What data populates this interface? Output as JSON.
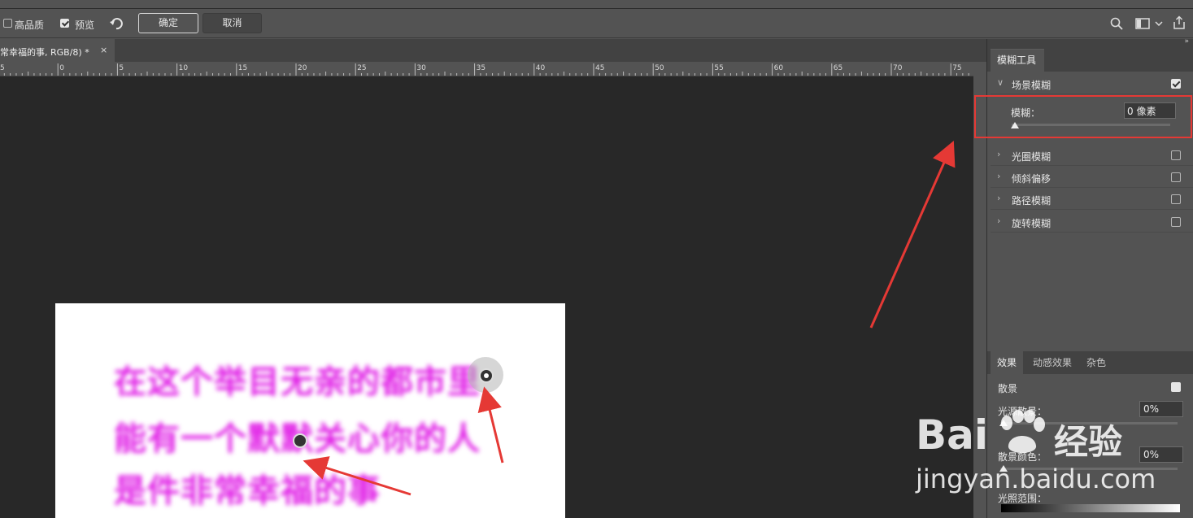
{
  "options_bar": {
    "high_quality_label": "高品质",
    "high_quality_checked": false,
    "preview_label": "预览",
    "preview_checked": true,
    "ok_label": "确定",
    "cancel_label": "取消",
    "icons": [
      "undo-icon",
      "search-icon",
      "workspace-icon",
      "chevron-down-icon",
      "share-icon"
    ]
  },
  "document_tab": {
    "title": "常幸福的事, RGB/8) *",
    "close_label": "×"
  },
  "ruler": {
    "labels": [
      "5",
      "0",
      "5",
      "10",
      "15",
      "20",
      "25",
      "30",
      "35",
      "40",
      "45",
      "50",
      "55",
      "60",
      "65",
      "70",
      "75"
    ]
  },
  "canvas": {
    "text_lines": [
      "在这个举目无亲的都市里",
      "能有一个默默关心你的人",
      "是件非常幸福的事"
    ],
    "text_color": "#e01fe6",
    "background": "#282828"
  },
  "blur_tools_panel": {
    "tab_label": "模糊工具",
    "field_blur": {
      "label": "场景模糊",
      "checked": true,
      "expanded": true,
      "blur_label": "模糊：",
      "blur_value": "0 像素"
    },
    "sections": [
      {
        "label": "光圈模糊",
        "checked": false
      },
      {
        "label": "倾斜偏移",
        "checked": false
      },
      {
        "label": "路径模糊",
        "checked": false
      },
      {
        "label": "旋转模糊",
        "checked": false
      }
    ]
  },
  "effects_panel": {
    "tabs": [
      "效果",
      "动感效果",
      "杂色"
    ],
    "active_tab": "效果",
    "bokeh_label": "散景",
    "bokeh_checked": true,
    "light_bokeh_label": "光源散景：",
    "light_bokeh_value": "0%",
    "bokeh_color_label": "散景颜色：",
    "bokeh_color_value": "0%",
    "light_range_label": "光照范围："
  },
  "watermark": {
    "brand": "Bai",
    "brand_cn": "经验",
    "url": "jingyan.baidu.com"
  },
  "colors": {
    "annotation": "#e53935",
    "panel": "#535353",
    "canvas": "#282828"
  }
}
